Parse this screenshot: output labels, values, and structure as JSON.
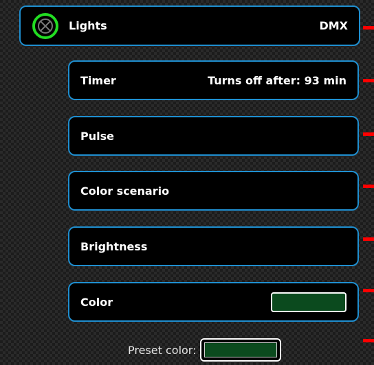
{
  "lights": {
    "label": "Lights",
    "mode": "DMX",
    "icon": "lightbulb-x-icon",
    "icon_color": "#22dd22"
  },
  "timer": {
    "label": "Timer",
    "value": "Turns off after: 93 min"
  },
  "pulse": {
    "label": "Pulse"
  },
  "color_scenario": {
    "label": "Color scenario"
  },
  "brightness": {
    "label": "Brightness"
  },
  "color": {
    "label": "Color",
    "value_color": "#0b4a1e"
  },
  "preset": {
    "label": "Preset color:",
    "value_color": "#0b4a1e"
  },
  "theme": {
    "accent_border": "#1f8fd0",
    "marker_color": "#ff0000"
  }
}
